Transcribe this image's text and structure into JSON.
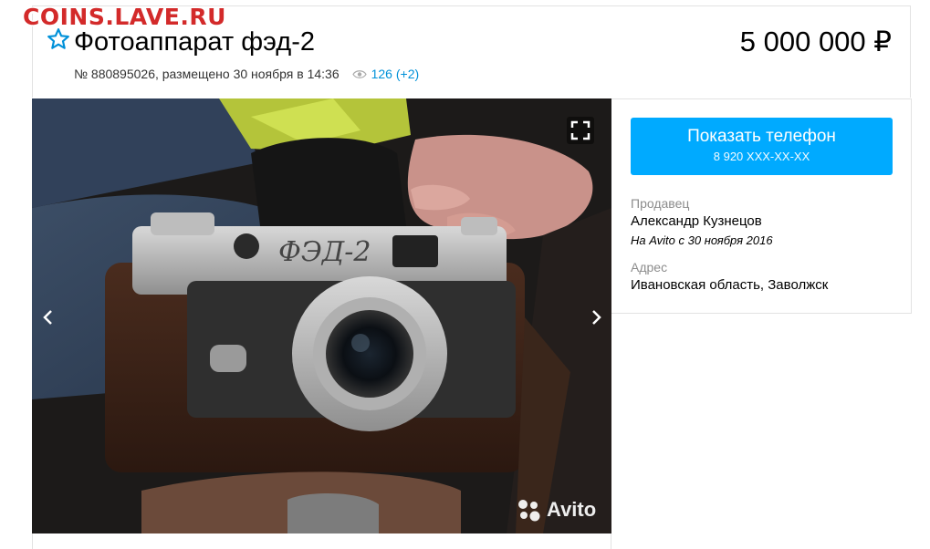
{
  "watermark": "COINS.LAVE.RU",
  "listing": {
    "title": "Фотоаппарат фэд-2",
    "price": "5 000 000 ₽",
    "meta": "№ 880895026, размещено 30 ноября в 14:36",
    "views": "126 (+2)"
  },
  "gallery": {
    "logo_text": "Avito",
    "camera_engraving": "ФЭД-2"
  },
  "contact": {
    "phone_button_label": "Показать телефон",
    "phone_number": "8 920 XXX-XX-XX"
  },
  "seller": {
    "caption": "Продавец",
    "name": "Александр Кузнецов",
    "since": "На Avito с 30 ноября 2016"
  },
  "address": {
    "caption": "Адрес",
    "value": "Ивановская область, Заволжск"
  },
  "icons": [
    "star-icon",
    "eye-icon",
    "fullscreen-icon",
    "chevron-left-icon",
    "chevron-right-icon",
    "avito-logo-icon"
  ],
  "colors": {
    "accent": "#00aaff",
    "link": "#0091d9",
    "watermark": "#d32a2a",
    "muted": "#8c8c8c"
  }
}
